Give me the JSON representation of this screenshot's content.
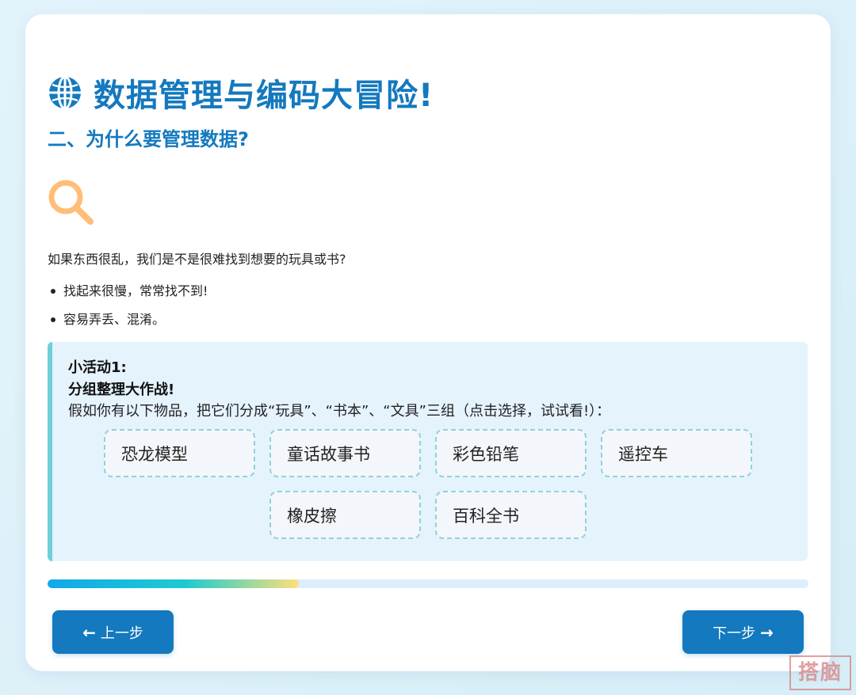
{
  "header": {
    "title": "数据管理与编码大冒险!",
    "subtitle": "二、为什么要管理数据?",
    "title_icon": "globe-icon"
  },
  "content": {
    "illustration_icon": "magnifier-icon",
    "question": "如果东西很乱，我们是不是很难找到想要的玩具或书?",
    "bullets": [
      "找起来很慢，常常找不到!",
      "容易弄丢、混淆。"
    ]
  },
  "activity": {
    "title": "小活动1:",
    "subtitle": "分组整理大作战!",
    "description": "假如你有以下物品，把它们分成“玩具”、“书本”、“文具”三组（点击选择，试试看!）：",
    "items": [
      "恐龙模型",
      "童话故事书",
      "彩色铅笔",
      "遥控车",
      "橡皮擦",
      "百科全书"
    ]
  },
  "progress": {
    "fraction": 0.33
  },
  "navigation": {
    "prev_label": "上一步",
    "next_label": "下一步",
    "prev_icon": "arrow-left-icon",
    "next_icon": "arrow-right-icon"
  },
  "watermark": {
    "text": "搭脑"
  },
  "colors": {
    "accent": "#1479be",
    "activity_bg": "#e5f3fd",
    "activity_border": "#6fcfd8",
    "icon_orange": "#ffbe78"
  }
}
